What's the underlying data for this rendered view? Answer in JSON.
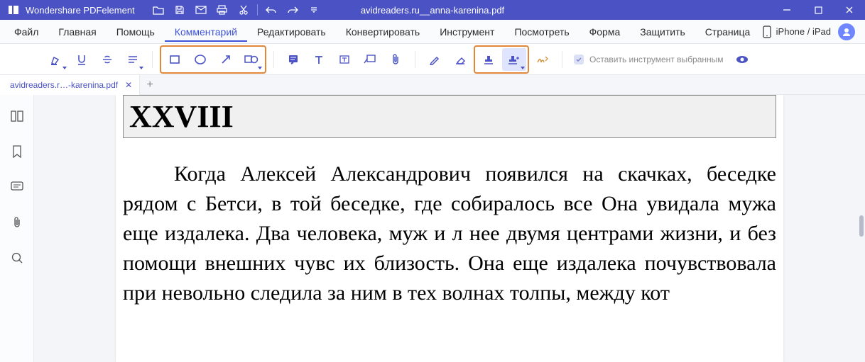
{
  "app": {
    "name": "Wondershare PDFelement"
  },
  "document": {
    "title": "avidreaders.ru__anna-karenina.pdf"
  },
  "menu": {
    "items": [
      "Файл",
      "Главная",
      "Помощь",
      "Комментарий",
      "Редактировать",
      "Конвертировать",
      "Инструмент",
      "Посмотреть",
      "Форма",
      "Защитить",
      "Страница"
    ],
    "active_index": 3,
    "device_label": "iPhone / iPad"
  },
  "toolbar": {
    "keep_tool_label": "Оставить инструмент выбранным"
  },
  "tabs": {
    "items": [
      {
        "label": "avidreaders.r…-karenina.pdf"
      }
    ]
  },
  "content": {
    "chapter": "XXVIII",
    "paragraph": "Когда Алексей Александрович появился на скачках, беседке рядом с Бетси, в той беседке, где собиралось все Она увидала мужа еще издалека. Два человека, муж и л нее двумя центрами жизни, и без помощи внешних чувс их близость. Она еще издалека почувствовала при невольно следила за ним в тех волнах толпы, между кот"
  }
}
